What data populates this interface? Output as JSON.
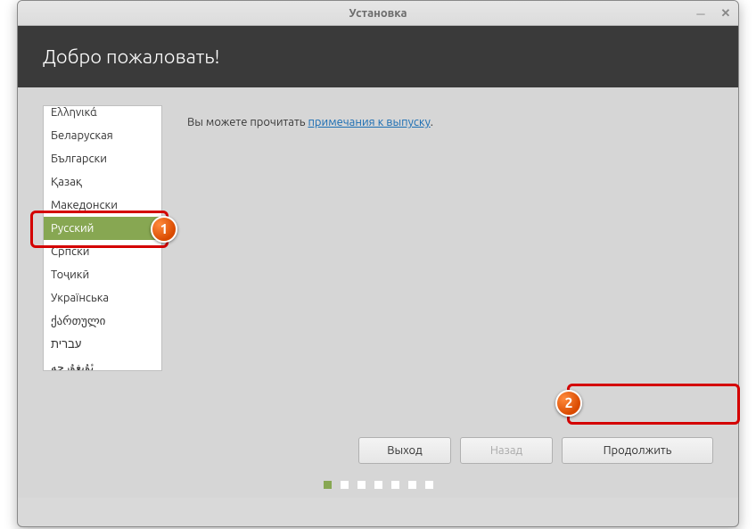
{
  "window": {
    "title": "Установка"
  },
  "header": {
    "title": "Добро пожаловать!"
  },
  "release": {
    "text_prefix": "Вы можете прочитать ",
    "link_text": "примечания к выпуску",
    "text_suffix": "."
  },
  "languages": {
    "items": [
      "Ελληνικά",
      "Беларуская",
      "Български",
      "Қазақ",
      "Македонски",
      "Русский",
      "Српски",
      "Тоҷикӣ",
      "Українська",
      "ქართული",
      "עברית",
      "ئۇيغۇرچە"
    ],
    "selected_index": 5
  },
  "buttons": {
    "quit": "Выход",
    "back": "Назад",
    "continue": "Продолжить"
  },
  "progress": {
    "total": 7,
    "active": 0
  },
  "annotations": {
    "badge1": "1",
    "badge2": "2"
  }
}
